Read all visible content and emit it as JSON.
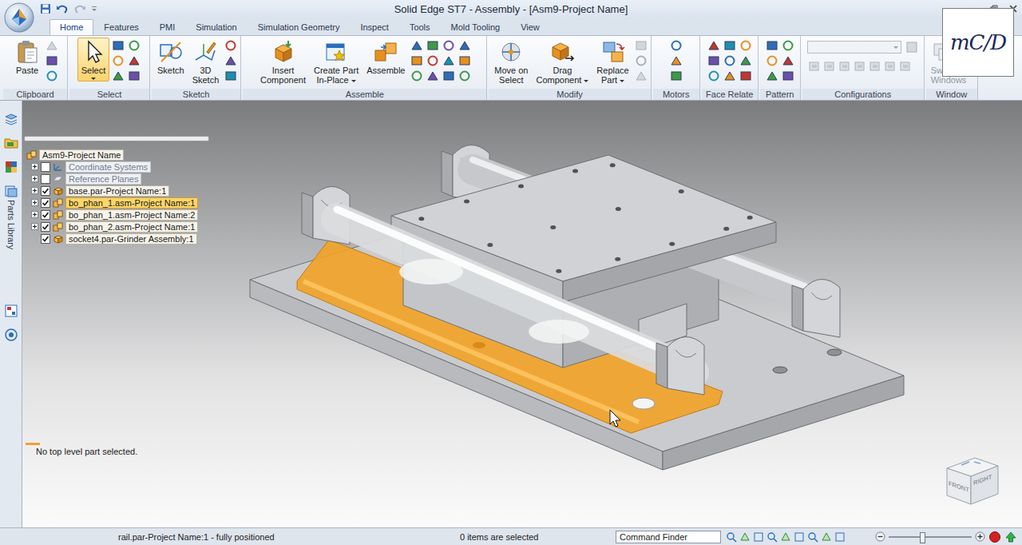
{
  "window": {
    "title": "Solid Edge ST7 - Assembly - [Asm9-Project Name]"
  },
  "logo": {
    "text": "mC/D"
  },
  "tabs": [
    {
      "label": "Home",
      "selected": true
    },
    {
      "label": "Features",
      "selected": false
    },
    {
      "label": "PMI",
      "selected": false
    },
    {
      "label": "Simulation",
      "selected": false
    },
    {
      "label": "Simulation Geometry",
      "selected": false
    },
    {
      "label": "Inspect",
      "selected": false
    },
    {
      "label": "Tools",
      "selected": false
    },
    {
      "label": "Mold Tooling",
      "selected": false
    },
    {
      "label": "View",
      "selected": false
    }
  ],
  "ribbon": {
    "groups": [
      {
        "label": "Clipboard",
        "buttons": [
          {
            "lines": [
              "Paste"
            ],
            "dropdown": false,
            "disabled": false,
            "selected": false
          }
        ],
        "combo": null
      },
      {
        "label": "Select",
        "buttons": [
          {
            "lines": [
              "Select"
            ],
            "dropdown": true,
            "disabled": false,
            "selected": true
          }
        ],
        "combo": null
      },
      {
        "label": "Sketch",
        "buttons": [
          {
            "lines": [
              "Sketch"
            ],
            "dropdown": false,
            "disabled": false,
            "selected": false
          },
          {
            "lines": [
              "3D",
              "Sketch"
            ],
            "dropdown": false,
            "disabled": false,
            "selected": false
          }
        ],
        "combo": null
      },
      {
        "label": "Assemble",
        "buttons": [
          {
            "lines": [
              "Insert",
              "Component"
            ],
            "dropdown": false,
            "disabled": false,
            "selected": false
          },
          {
            "lines": [
              "Create Part",
              "In-Place"
            ],
            "dropdown": true,
            "disabled": false,
            "selected": false
          },
          {
            "lines": [
              "Assemble"
            ],
            "dropdown": false,
            "disabled": false,
            "selected": false
          }
        ],
        "combo": null
      },
      {
        "label": "Modify",
        "buttons": [
          {
            "lines": [
              "Move on",
              "Select"
            ],
            "dropdown": false,
            "disabled": false,
            "selected": false
          },
          {
            "lines": [
              "Drag",
              "Component"
            ],
            "dropdown": true,
            "disabled": false,
            "selected": false
          },
          {
            "lines": [
              "Replace",
              "Part"
            ],
            "dropdown": true,
            "disabled": false,
            "selected": false
          }
        ],
        "combo": null
      },
      {
        "label": "Motors",
        "buttons": [],
        "combo": null
      },
      {
        "label": "Face Relate",
        "buttons": [],
        "combo": null
      },
      {
        "label": "Pattern",
        "buttons": [],
        "combo": null
      },
      {
        "label": "Configurations",
        "buttons": [],
        "combo": {
          "value": "",
          "disabled": true
        }
      },
      {
        "label": "Window",
        "buttons": [
          {
            "lines": [
              "Sw",
              "Windows"
            ],
            "dropdown": false,
            "disabled": true,
            "selected": false
          }
        ],
        "combo": null
      }
    ]
  },
  "side_toolbar": {
    "label": "Parts Library"
  },
  "tree": {
    "root": {
      "label": "Asm9-Project Name"
    },
    "items": [
      {
        "label": "Coordinate Systems",
        "kind": "coordinate",
        "expandable": true,
        "checked": false,
        "greyed": true,
        "selected": false
      },
      {
        "label": "Reference Planes",
        "kind": "planes",
        "expandable": true,
        "checked": false,
        "greyed": true,
        "selected": false
      },
      {
        "label": "base.par-Project Name:1",
        "kind": "part",
        "expandable": true,
        "checked": true,
        "greyed": false,
        "selected": false
      },
      {
        "label": "bo_phan_1.asm-Project Name:1",
        "kind": "assembly",
        "expandable": true,
        "checked": true,
        "greyed": false,
        "selected": true
      },
      {
        "label": "bo_phan_1.asm-Project Name:2",
        "kind": "assembly",
        "expandable": true,
        "checked": true,
        "greyed": false,
        "selected": false
      },
      {
        "label": "bo_phan_2.asm-Project Name:1",
        "kind": "assembly",
        "expandable": true,
        "checked": true,
        "greyed": false,
        "selected": false
      },
      {
        "label": "socket4.par-Grinder Assembly:1",
        "kind": "part",
        "expandable": false,
        "checked": true,
        "greyed": false,
        "selected": false
      }
    ]
  },
  "prompt": "No top level part selected.",
  "viewport": {
    "hover_highlight": true
  },
  "view_cube": {
    "faces": [
      "FRONT",
      "RIGHT"
    ]
  },
  "status_bar": {
    "message": "rail.par-Project Name:1 - fully positioned",
    "selection": "0 items are selected",
    "command_finder": "Command Finder",
    "zoom": {
      "level": 0.4
    }
  }
}
